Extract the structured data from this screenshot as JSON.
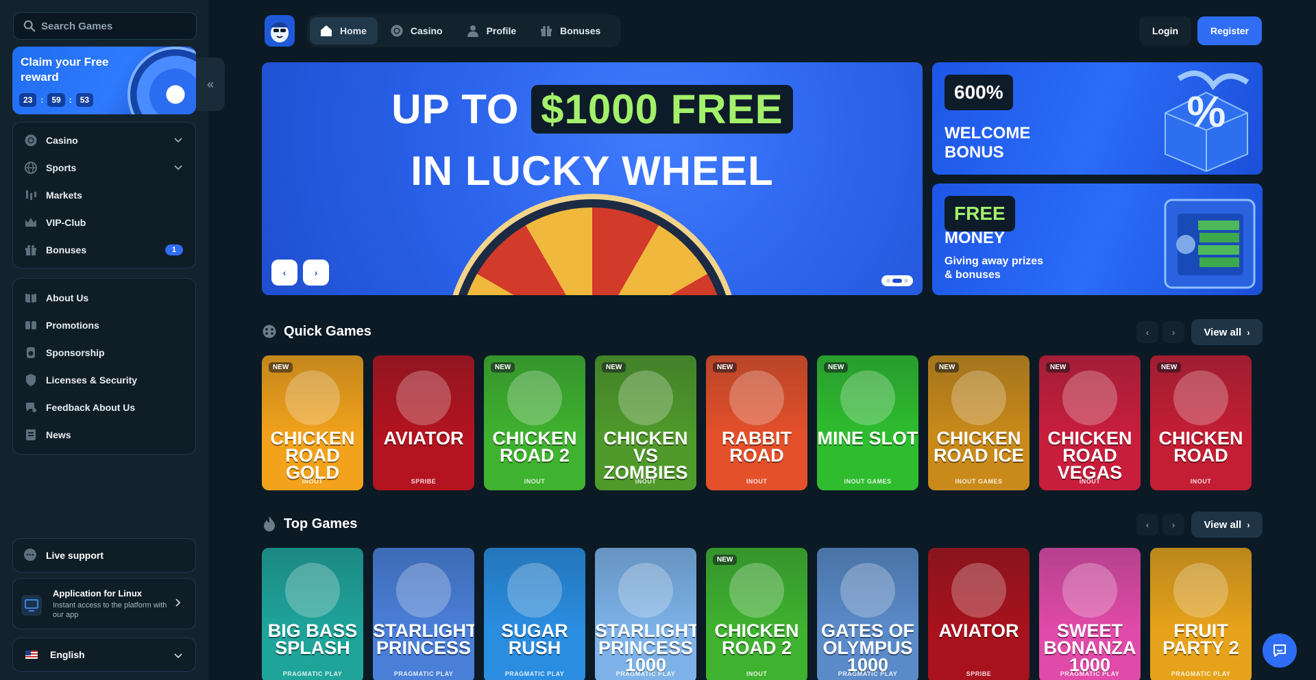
{
  "sidebar": {
    "search_placeholder": "Search Games",
    "reward": {
      "title": "Claim your Free reward",
      "hours": "23",
      "minutes": "59",
      "seconds": "53",
      "sep": ":"
    },
    "menu": [
      {
        "label": "Casino",
        "icon": "chip-icon",
        "chevron": true
      },
      {
        "label": "Sports",
        "icon": "globe-icon",
        "chevron": true
      },
      {
        "label": "Markets",
        "icon": "candles-icon"
      },
      {
        "label": "VIP-Club",
        "icon": "crown-icon"
      },
      {
        "label": "Bonuses",
        "icon": "gift-icon",
        "badge": "1"
      }
    ],
    "info": [
      {
        "label": "About Us",
        "icon": "book-icon"
      },
      {
        "label": "Promotions",
        "icon": "ticket-icon"
      },
      {
        "label": "Sponsorship",
        "icon": "medal-icon"
      },
      {
        "label": "Licenses & Security",
        "icon": "shield-icon"
      },
      {
        "label": "Feedback About Us",
        "icon": "feedback-icon"
      },
      {
        "label": "News",
        "icon": "newspaper-icon"
      }
    ],
    "support": "Live support",
    "app": {
      "title": "Application for Linux",
      "desc": "Instant access to the platform with our app"
    },
    "language": "English"
  },
  "topnav": {
    "items": [
      {
        "label": "Home",
        "icon": "home-icon",
        "active": true
      },
      {
        "label": "Casino",
        "icon": "chip-icon"
      },
      {
        "label": "Profile",
        "icon": "user-icon"
      },
      {
        "label": "Bonuses",
        "icon": "gift-icon"
      }
    ],
    "login": "Login",
    "register": "Register"
  },
  "hero": {
    "line1_prefix": "UP TO",
    "line1_highlight": "$1000 FREE",
    "line2": "IN LUCKY WHEEL",
    "prev": "‹",
    "next": "›"
  },
  "promos": [
    {
      "tag": "600%",
      "title": "WELCOME BONUS"
    },
    {
      "tag": "FREE",
      "title": "MONEY",
      "subtitle": "Giving away prizes & bonuses"
    }
  ],
  "quick_games": {
    "title": "Quick Games",
    "view_all": "View all",
    "items": [
      {
        "name": "CHICKEN ROAD GOLD",
        "provider": "INOUT",
        "new": true,
        "bg": "#f2a21b"
      },
      {
        "name": "AVIATOR",
        "provider": "SPRIBE",
        "new": false,
        "bg": "#b3141f"
      },
      {
        "name": "CHICKEN ROAD 2",
        "provider": "INOUT",
        "new": true,
        "bg": "#3fb22f"
      },
      {
        "name": "CHICKEN VS ZOMBIES",
        "provider": "INOUT",
        "new": true,
        "bg": "#4f9a2a"
      },
      {
        "name": "RABBIT ROAD",
        "provider": "INOUT",
        "new": true,
        "bg": "#e4502a"
      },
      {
        "name": "MINE SLOT",
        "provider": "INOUT GAMES",
        "new": true,
        "bg": "#2fbd2f"
      },
      {
        "name": "CHICKEN ROAD ICE",
        "provider": "INOUT GAMES",
        "new": true,
        "bg": "#c98a1a"
      },
      {
        "name": "CHICKEN ROAD VEGAS",
        "provider": "INOUT",
        "new": true,
        "bg": "#c81e3c"
      },
      {
        "name": "CHICKEN ROAD",
        "provider": "INOUT",
        "new": true,
        "bg": "#c41e34"
      }
    ],
    "new_label": "NEW"
  },
  "top_games": {
    "title": "Top Games",
    "view_all": "View all",
    "items": [
      {
        "name": "BIG BASS SPLASH",
        "provider": "PRAGMATIC PLAY",
        "new": false,
        "bg": "#1fa49a"
      },
      {
        "name": "STARLIGHT PRINCESS",
        "provider": "PRAGMATIC PLAY",
        "new": false,
        "bg": "#4a7fd8"
      },
      {
        "name": "SUGAR RUSH",
        "provider": "PRAGMATIC PLAY",
        "new": false,
        "bg": "#2a8de0"
      },
      {
        "name": "STARLIGHT PRINCESS 1000",
        "provider": "PRAGMATIC PLAY",
        "new": false,
        "bg": "#7db2e8"
      },
      {
        "name": "CHICKEN ROAD 2",
        "provider": "INOUT",
        "new": true,
        "bg": "#3fb22f"
      },
      {
        "name": "GATES OF OLYMPUS 1000",
        "provider": "PRAGMATIC PLAY",
        "new": false,
        "bg": "#5a8ac8"
      },
      {
        "name": "AVIATOR",
        "provider": "SPRIBE",
        "new": false,
        "bg": "#a8121c"
      },
      {
        "name": "SWEET BONANZA 1000",
        "provider": "PRAGMATIC PLAY",
        "new": false,
        "bg": "#e04aa8"
      },
      {
        "name": "FRUIT PARTY 2",
        "provider": "PRAGMATIC PLAY",
        "new": false,
        "bg": "#e6a21a"
      }
    ],
    "new_label": "NEW"
  },
  "colors": {
    "accent": "#2f6df5",
    "bg": "#0b1a24",
    "sidebar": "#13232e",
    "highlight_green": "#a3f06a"
  }
}
